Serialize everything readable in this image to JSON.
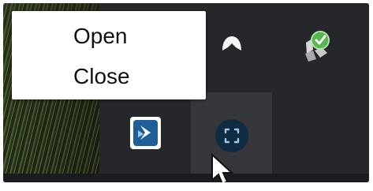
{
  "context_menu": {
    "items": [
      {
        "label": "Open"
      },
      {
        "label": "Close"
      }
    ]
  },
  "tray": {
    "icons": [
      "arrow-up-icon",
      "vpn-shield-icon",
      "app-icon",
      "screen-capture-icon"
    ],
    "hovered": "screen-capture-icon"
  },
  "cursor": "mouse-pointer-icon",
  "colors": {
    "tray_background": "#26272a",
    "hover_background": "#36373b",
    "menu_background": "#ffffff",
    "menu_text": "#111111",
    "app_icon_blue": "#1f5f97",
    "capture_icon_dark": "#0f2c42",
    "vpn_green": "#55b84a"
  }
}
